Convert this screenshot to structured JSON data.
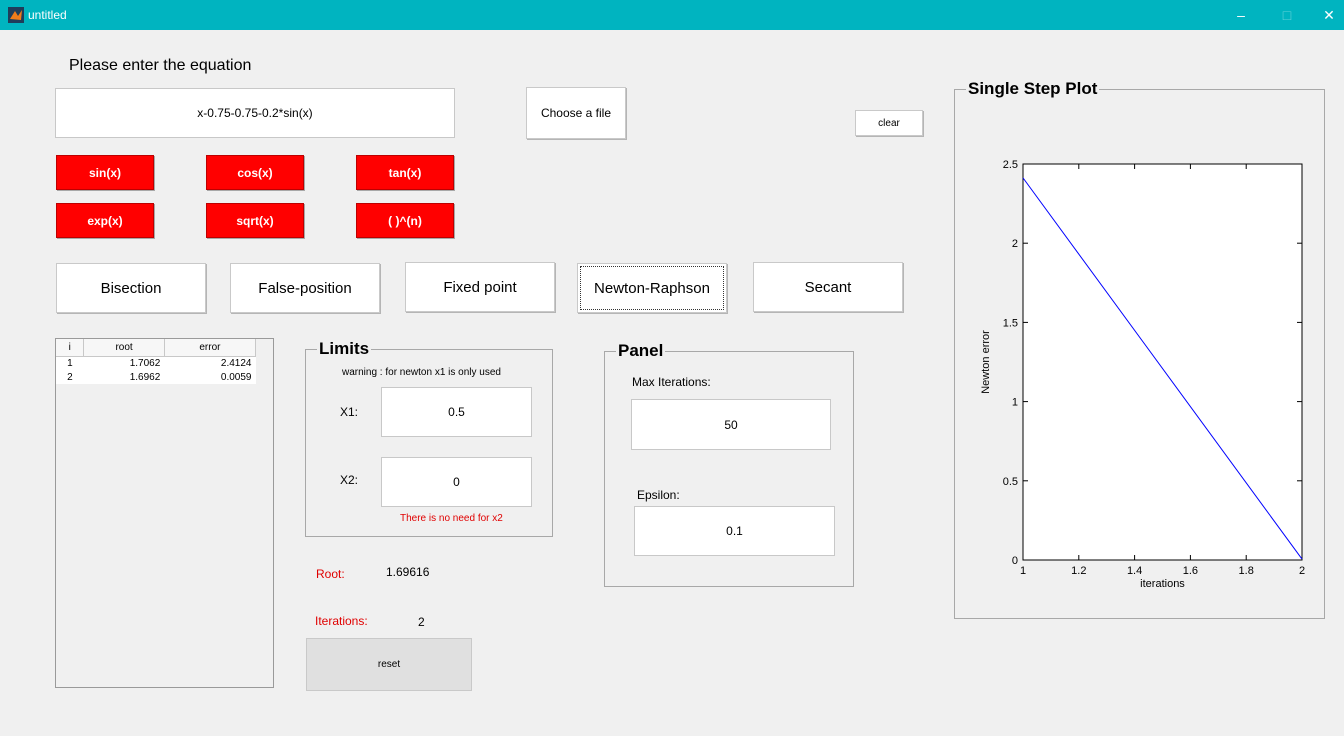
{
  "window": {
    "title": "untitled",
    "minimize": "–",
    "maximize": "□",
    "close": "✕"
  },
  "equation": {
    "prompt": "Please enter the equation",
    "value": "x-0.75-0.75-0.2*sin(x)",
    "choose_file_label": "Choose a file",
    "clear_label": "clear"
  },
  "function_buttons": [
    {
      "label": "sin(x)"
    },
    {
      "label": "cos(x)"
    },
    {
      "label": "tan(x)"
    },
    {
      "label": "exp(x)"
    },
    {
      "label": "sqrt(x)"
    },
    {
      "label": "( )^(n)"
    }
  ],
  "methods": [
    {
      "label": "Bisection"
    },
    {
      "label": "False-position"
    },
    {
      "label": "Fixed point"
    },
    {
      "label": "Newton-Raphson"
    },
    {
      "label": "Secant"
    }
  ],
  "results_table": {
    "columns": [
      "i",
      "root",
      "error"
    ],
    "rows": [
      [
        "1",
        "1.7062",
        "2.4124"
      ],
      [
        "2",
        "1.6962",
        "0.0059"
      ]
    ]
  },
  "limits": {
    "title": "Limits",
    "warning": "warning : for newton x1 is only used",
    "x1_label": "X1:",
    "x1_value": "0.5",
    "x2_label": "X2:",
    "x2_value": "0",
    "x2_note": "There is no need for x2"
  },
  "panel": {
    "title": "Panel",
    "max_iter_label": "Max Iterations:",
    "max_iter_value": "50",
    "epsilon_label": "Epsilon:",
    "epsilon_value": "0.1"
  },
  "output": {
    "root_label": "Root:",
    "root_value": "1.69616",
    "iterations_label": "Iterations:",
    "iterations_value": "2",
    "reset_label": "reset"
  },
  "plot_panel": {
    "title": "Single Step Plot"
  },
  "colors": {
    "titlebar": "#00b4c0",
    "function_button": "#ff0000",
    "warning_text": "#e00000",
    "series_line": "#0000ff"
  },
  "chart_data": {
    "type": "line",
    "title": "",
    "xlabel": "iterations",
    "ylabel": "Newton error",
    "xlim": [
      1,
      2
    ],
    "ylim": [
      0,
      2.5
    ],
    "x_ticks": [
      "1",
      "1.2",
      "1.4",
      "1.6",
      "1.8",
      "2"
    ],
    "y_ticks": [
      "0",
      "0.5",
      "1",
      "1.5",
      "2",
      "2.5"
    ],
    "grid": false,
    "series": [
      {
        "x": [
          1,
          2
        ],
        "y": [
          2.4124,
          0.0059
        ]
      }
    ]
  }
}
